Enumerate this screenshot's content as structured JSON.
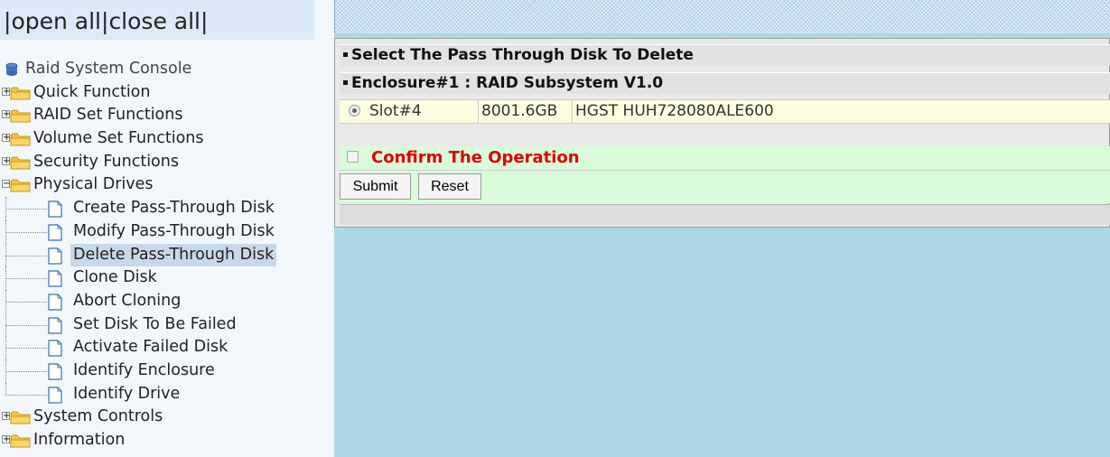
{
  "left_frame": {
    "open_close": {
      "sep": "|",
      "open_all": "open all",
      "close_all": "close all"
    },
    "root_label": "Raid System Console",
    "categories_top": [
      {
        "label": "Quick Function",
        "expanded": false
      },
      {
        "label": "RAID Set Functions",
        "expanded": false
      },
      {
        "label": "Volume Set Functions",
        "expanded": false
      },
      {
        "label": "Security Functions",
        "expanded": false
      },
      {
        "label": "Physical Drives",
        "expanded": true
      }
    ],
    "physical_drive_items": [
      {
        "label": "Create Pass-Through Disk",
        "active": false
      },
      {
        "label": "Modify Pass-Through Disk",
        "active": false
      },
      {
        "label": "Delete Pass-Through Disk",
        "active": true
      },
      {
        "label": "Clone Disk",
        "active": false
      },
      {
        "label": "Abort Cloning",
        "active": false
      },
      {
        "label": "Set Disk To Be Failed",
        "active": false
      },
      {
        "label": "Activate Failed Disk",
        "active": false
      },
      {
        "label": "Identify Enclosure",
        "active": false
      },
      {
        "label": "Identify Drive",
        "active": false
      }
    ],
    "categories_bottom": [
      {
        "label": "System Controls",
        "expanded": false
      },
      {
        "label": "Information",
        "expanded": false
      }
    ]
  },
  "form": {
    "title": "Select The Pass Through Disk To Delete",
    "enclosure": "Enclosure#1 : RAID Subsystem V1.0",
    "disk": {
      "slot": "Slot#4",
      "capacity": "8001.6GB",
      "model": "HGST HUH728080ALE600",
      "selected": true
    },
    "confirm_label": "Confirm The Operation",
    "confirm_checked": false,
    "submit_label": "Submit",
    "reset_label": "Reset"
  },
  "colors": {
    "frame_background": "#add8e6",
    "confirm_text": "#e00000",
    "confirm_row": "#d9fbd9",
    "disk_row": "#fdfde0",
    "active_item": "#c8d8e8"
  },
  "icons": {
    "root": "console-icon",
    "category": "folder-icon",
    "expander": "plus-minus-icon",
    "item": "document-icon"
  }
}
